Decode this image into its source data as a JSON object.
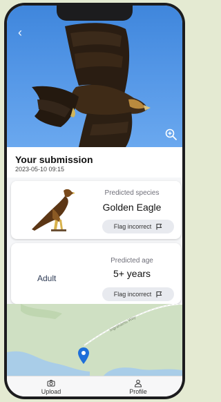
{
  "submission": {
    "title": "Your submission",
    "datetime": "2023-05-10 09:15"
  },
  "species_card": {
    "label": "Predicted species",
    "value": "Golden Eagle",
    "flag_label": "Flag incorrect"
  },
  "age_card": {
    "category": "Adult",
    "label": "Predicted age",
    "value": "5+ years",
    "flag_label": "Flag incorrect"
  },
  "map": {
    "road_label": "Ingrahams Way"
  },
  "nav": {
    "items": [
      {
        "label": "Upload",
        "icon": "camera-icon"
      },
      {
        "label": "Profile",
        "icon": "person-icon"
      }
    ]
  },
  "colors": {
    "sky": "#4f93e4",
    "map_pin": "#1e6fd9",
    "pill_bg": "#e8eaef"
  }
}
